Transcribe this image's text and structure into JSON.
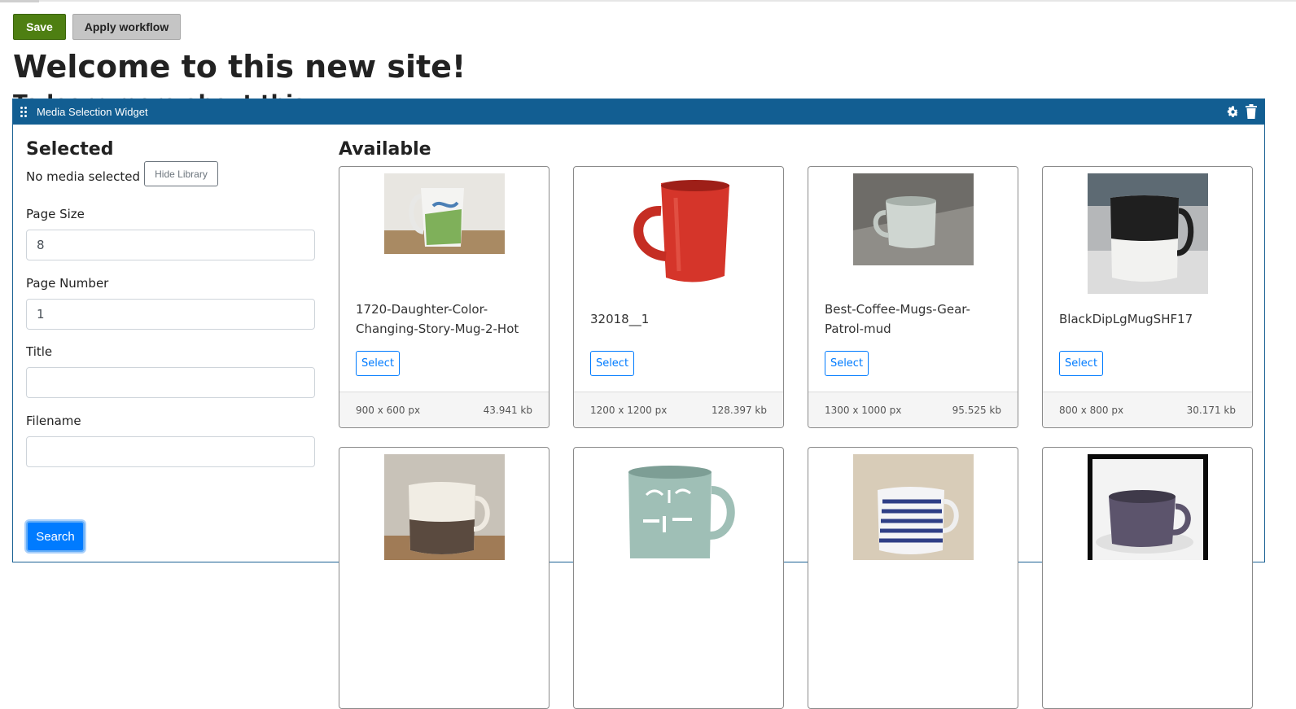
{
  "toolbar": {
    "save_label": "Save",
    "workflow_label": "Apply workflow"
  },
  "page": {
    "title": "Welcome to this new site!",
    "subtitle": "To learn more about this"
  },
  "widget": {
    "title": "Media Selection Widget",
    "icons": [
      "drag-handle-icon",
      "gear-icon",
      "trash-icon"
    ],
    "header_color": "#125e92"
  },
  "selected": {
    "heading": "Selected",
    "status": "No media selected",
    "hide_library_label": "Hide Library"
  },
  "filters": {
    "page_size": {
      "label": "Page Size",
      "value": "8"
    },
    "page_number": {
      "label": "Page Number",
      "value": "1"
    },
    "title": {
      "label": "Title",
      "value": ""
    },
    "filename": {
      "label": "Filename",
      "value": ""
    },
    "search_label": "Search"
  },
  "available": {
    "heading": "Available",
    "items": [
      {
        "name": "1720-Daughter-Color-Changing-Story-Mug-2-Hot",
        "dimensions": "900 x 600 px",
        "size": "43.941 kb",
        "select_label": "Select"
      },
      {
        "name": "32018__1",
        "dimensions": "1200 x 1200 px",
        "size": "128.397 kb",
        "select_label": "Select"
      },
      {
        "name": "Best-Coffee-Mugs-Gear-Patrol-mud",
        "dimensions": "1300 x 1000 px",
        "size": "95.525 kb",
        "select_label": "Select"
      },
      {
        "name": "BlackDipLgMugSHF17",
        "dimensions": "800 x 800 px",
        "size": "30.171 kb",
        "select_label": "Select"
      },
      {
        "name": "",
        "dimensions": "",
        "size": "",
        "select_label": ""
      },
      {
        "name": "",
        "dimensions": "",
        "size": "",
        "select_label": ""
      },
      {
        "name": "",
        "dimensions": "",
        "size": "",
        "select_label": ""
      },
      {
        "name": "",
        "dimensions": "",
        "size": "",
        "select_label": ""
      }
    ]
  },
  "colors": {
    "save": "#4e7f12",
    "primary": "#007bff"
  }
}
